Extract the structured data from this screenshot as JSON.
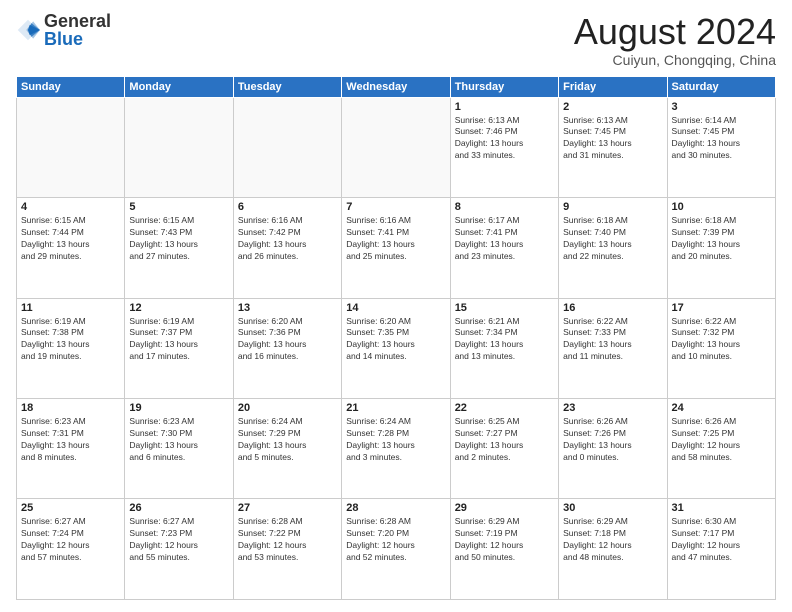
{
  "header": {
    "logo_general": "General",
    "logo_blue": "Blue",
    "month_title": "August 2024",
    "location": "Cuiyun, Chongqing, China"
  },
  "weekdays": [
    "Sunday",
    "Monday",
    "Tuesday",
    "Wednesday",
    "Thursday",
    "Friday",
    "Saturday"
  ],
  "weeks": [
    [
      {
        "day": "",
        "info": ""
      },
      {
        "day": "",
        "info": ""
      },
      {
        "day": "",
        "info": ""
      },
      {
        "day": "",
        "info": ""
      },
      {
        "day": "1",
        "info": "Sunrise: 6:13 AM\nSunset: 7:46 PM\nDaylight: 13 hours\nand 33 minutes."
      },
      {
        "day": "2",
        "info": "Sunrise: 6:13 AM\nSunset: 7:45 PM\nDaylight: 13 hours\nand 31 minutes."
      },
      {
        "day": "3",
        "info": "Sunrise: 6:14 AM\nSunset: 7:45 PM\nDaylight: 13 hours\nand 30 minutes."
      }
    ],
    [
      {
        "day": "4",
        "info": "Sunrise: 6:15 AM\nSunset: 7:44 PM\nDaylight: 13 hours\nand 29 minutes."
      },
      {
        "day": "5",
        "info": "Sunrise: 6:15 AM\nSunset: 7:43 PM\nDaylight: 13 hours\nand 27 minutes."
      },
      {
        "day": "6",
        "info": "Sunrise: 6:16 AM\nSunset: 7:42 PM\nDaylight: 13 hours\nand 26 minutes."
      },
      {
        "day": "7",
        "info": "Sunrise: 6:16 AM\nSunset: 7:41 PM\nDaylight: 13 hours\nand 25 minutes."
      },
      {
        "day": "8",
        "info": "Sunrise: 6:17 AM\nSunset: 7:41 PM\nDaylight: 13 hours\nand 23 minutes."
      },
      {
        "day": "9",
        "info": "Sunrise: 6:18 AM\nSunset: 7:40 PM\nDaylight: 13 hours\nand 22 minutes."
      },
      {
        "day": "10",
        "info": "Sunrise: 6:18 AM\nSunset: 7:39 PM\nDaylight: 13 hours\nand 20 minutes."
      }
    ],
    [
      {
        "day": "11",
        "info": "Sunrise: 6:19 AM\nSunset: 7:38 PM\nDaylight: 13 hours\nand 19 minutes."
      },
      {
        "day": "12",
        "info": "Sunrise: 6:19 AM\nSunset: 7:37 PM\nDaylight: 13 hours\nand 17 minutes."
      },
      {
        "day": "13",
        "info": "Sunrise: 6:20 AM\nSunset: 7:36 PM\nDaylight: 13 hours\nand 16 minutes."
      },
      {
        "day": "14",
        "info": "Sunrise: 6:20 AM\nSunset: 7:35 PM\nDaylight: 13 hours\nand 14 minutes."
      },
      {
        "day": "15",
        "info": "Sunrise: 6:21 AM\nSunset: 7:34 PM\nDaylight: 13 hours\nand 13 minutes."
      },
      {
        "day": "16",
        "info": "Sunrise: 6:22 AM\nSunset: 7:33 PM\nDaylight: 13 hours\nand 11 minutes."
      },
      {
        "day": "17",
        "info": "Sunrise: 6:22 AM\nSunset: 7:32 PM\nDaylight: 13 hours\nand 10 minutes."
      }
    ],
    [
      {
        "day": "18",
        "info": "Sunrise: 6:23 AM\nSunset: 7:31 PM\nDaylight: 13 hours\nand 8 minutes."
      },
      {
        "day": "19",
        "info": "Sunrise: 6:23 AM\nSunset: 7:30 PM\nDaylight: 13 hours\nand 6 minutes."
      },
      {
        "day": "20",
        "info": "Sunrise: 6:24 AM\nSunset: 7:29 PM\nDaylight: 13 hours\nand 5 minutes."
      },
      {
        "day": "21",
        "info": "Sunrise: 6:24 AM\nSunset: 7:28 PM\nDaylight: 13 hours\nand 3 minutes."
      },
      {
        "day": "22",
        "info": "Sunrise: 6:25 AM\nSunset: 7:27 PM\nDaylight: 13 hours\nand 2 minutes."
      },
      {
        "day": "23",
        "info": "Sunrise: 6:26 AM\nSunset: 7:26 PM\nDaylight: 13 hours\nand 0 minutes."
      },
      {
        "day": "24",
        "info": "Sunrise: 6:26 AM\nSunset: 7:25 PM\nDaylight: 12 hours\nand 58 minutes."
      }
    ],
    [
      {
        "day": "25",
        "info": "Sunrise: 6:27 AM\nSunset: 7:24 PM\nDaylight: 12 hours\nand 57 minutes."
      },
      {
        "day": "26",
        "info": "Sunrise: 6:27 AM\nSunset: 7:23 PM\nDaylight: 12 hours\nand 55 minutes."
      },
      {
        "day": "27",
        "info": "Sunrise: 6:28 AM\nSunset: 7:22 PM\nDaylight: 12 hours\nand 53 minutes."
      },
      {
        "day": "28",
        "info": "Sunrise: 6:28 AM\nSunset: 7:20 PM\nDaylight: 12 hours\nand 52 minutes."
      },
      {
        "day": "29",
        "info": "Sunrise: 6:29 AM\nSunset: 7:19 PM\nDaylight: 12 hours\nand 50 minutes."
      },
      {
        "day": "30",
        "info": "Sunrise: 6:29 AM\nSunset: 7:18 PM\nDaylight: 12 hours\nand 48 minutes."
      },
      {
        "day": "31",
        "info": "Sunrise: 6:30 AM\nSunset: 7:17 PM\nDaylight: 12 hours\nand 47 minutes."
      }
    ]
  ]
}
